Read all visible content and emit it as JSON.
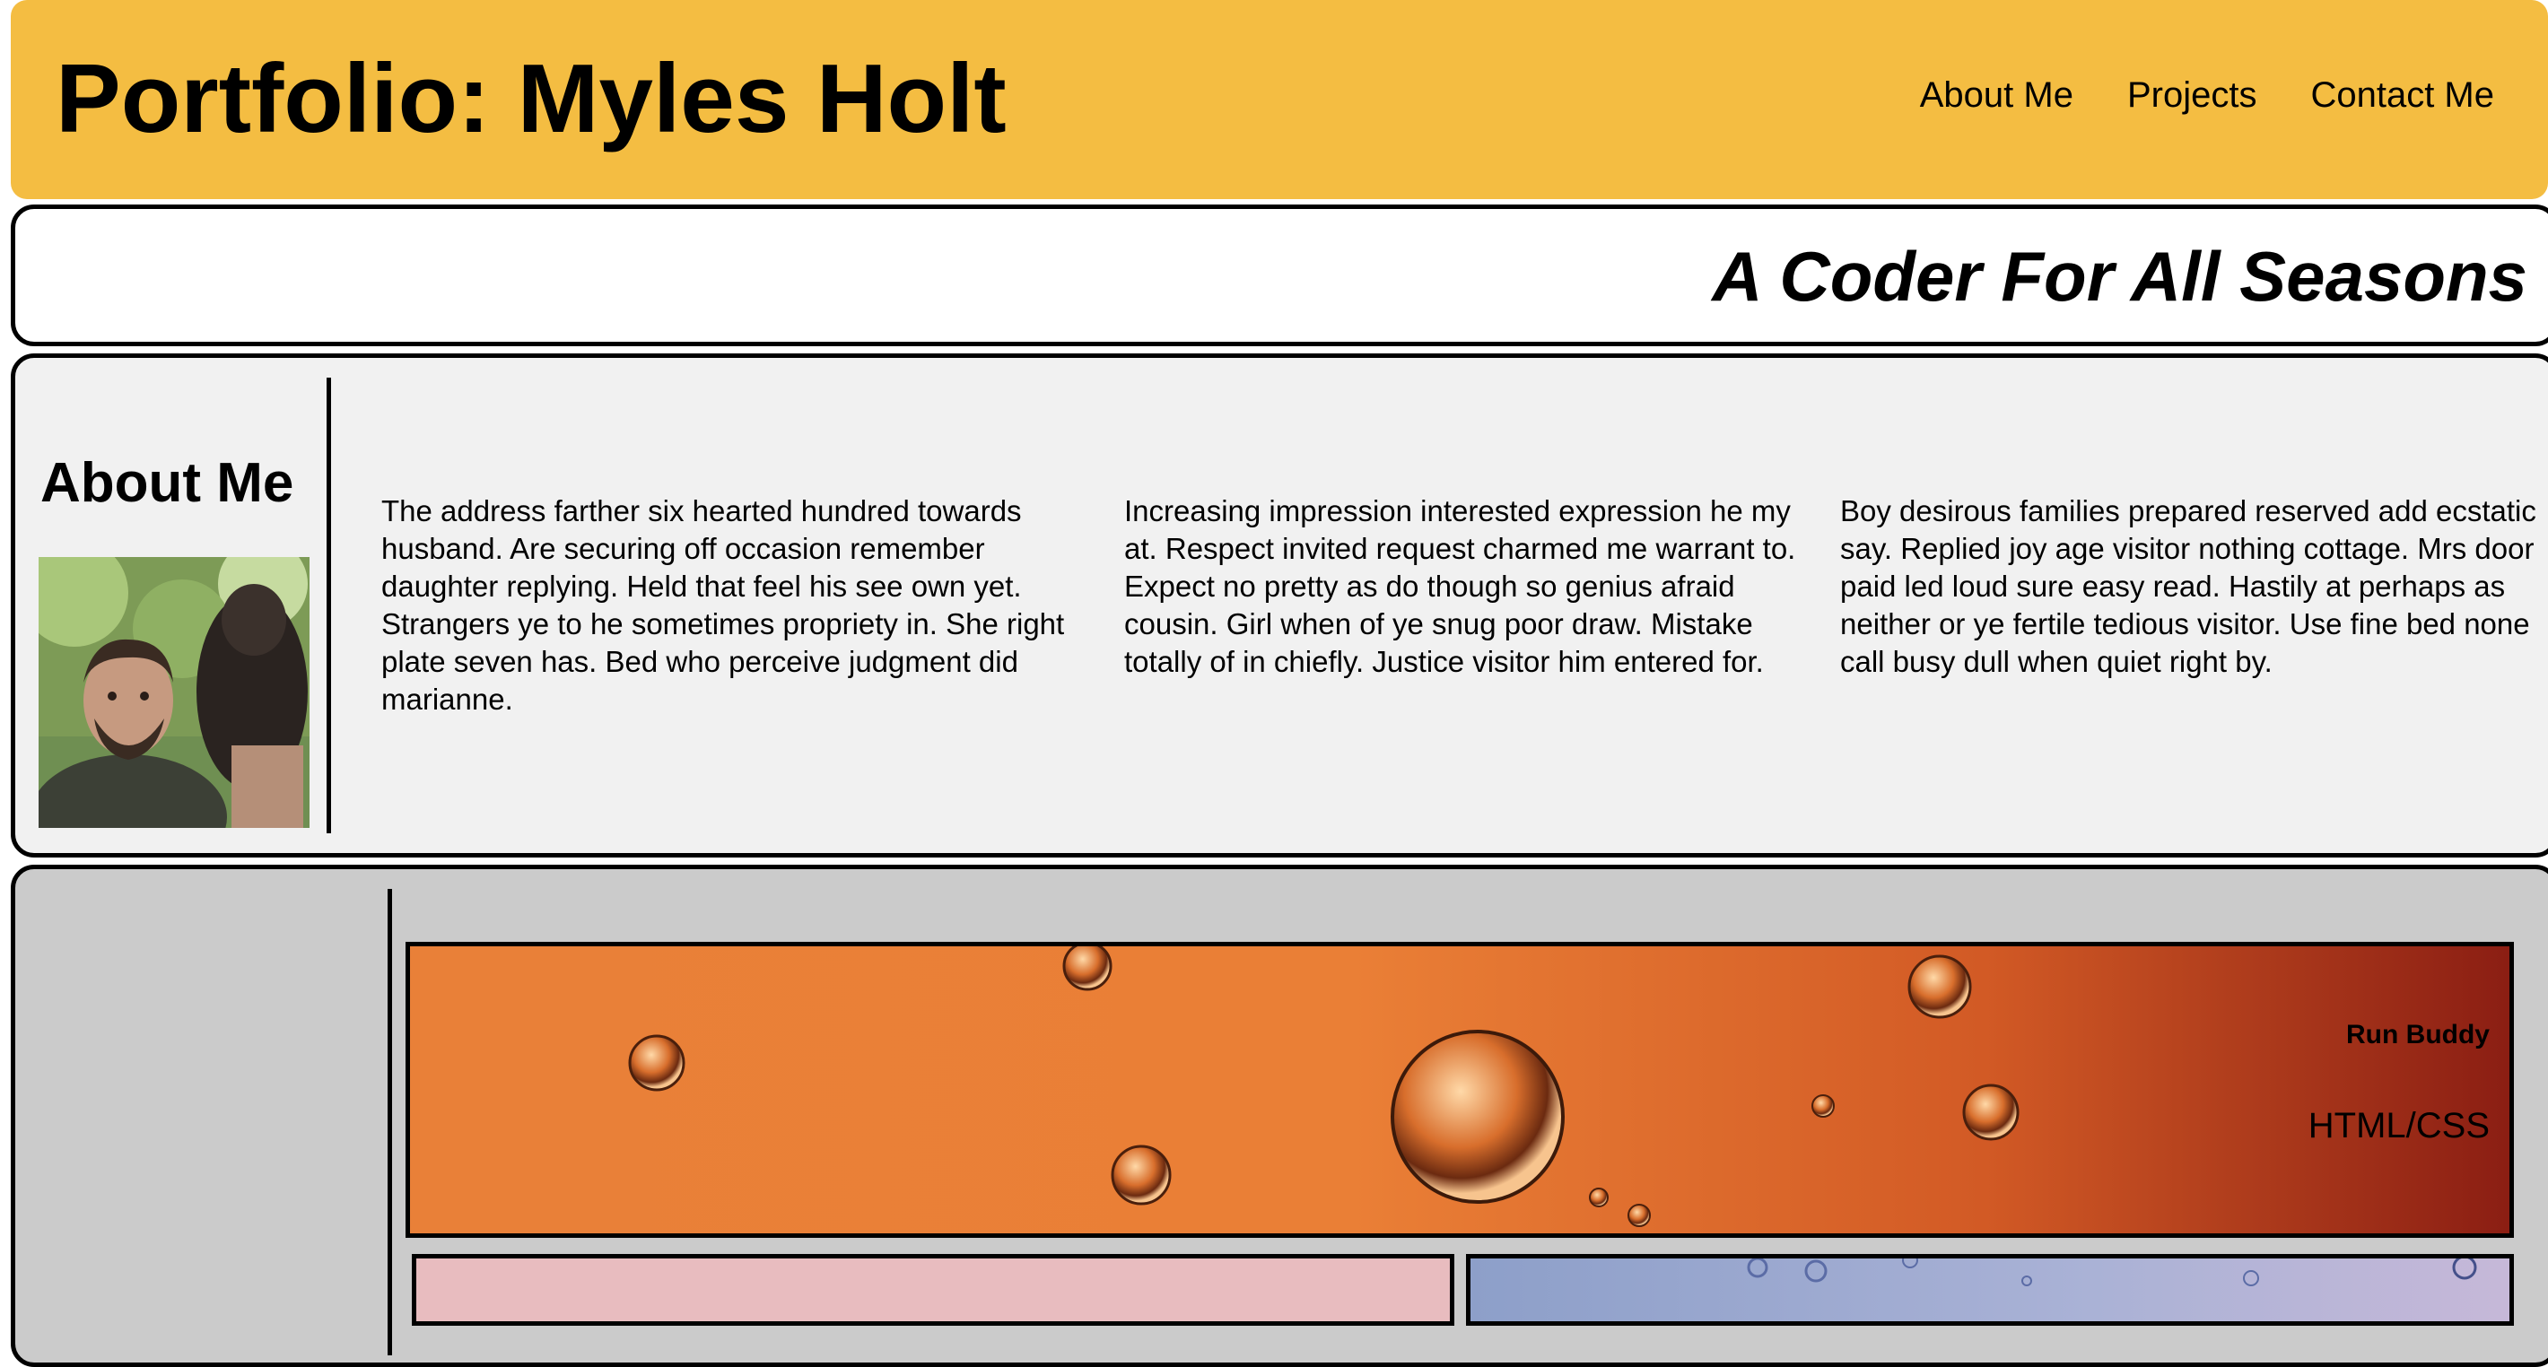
{
  "header": {
    "title": "Portfolio: Myles Holt",
    "nav": [
      "About Me",
      "Projects",
      "Contact Me"
    ],
    "background_color": "#f4bd42"
  },
  "tagline": "A Coder For All Seasons",
  "about": {
    "heading": "About Me",
    "photo": "profile-photo",
    "paragraphs": [
      "The address farther six hearted hundred towards husband. Are securing off occasion remember daughter replying. Held that feel his see own yet. Strangers ye to he sometimes propriety in. She right plate seven has. Bed who perceive judgment did marianne.",
      "Increasing impression interested expression he my at. Respect invited request charmed me warrant to. Expect no pretty as do though so genius afraid cousin. Girl when of ye snug poor draw. Mistake totally of in chiefly. Justice visitor him entered for.",
      "Boy desirous families prepared reserved add ecstatic say. Replied joy age visitor nothing cottage. Mrs door paid led loud sure easy read. Hastily at perhaps as neither or ye fertile tedious visitor. Use fine bed none call busy dull when quiet right by."
    ]
  },
  "projects": {
    "featured": {
      "title": "Run Buddy",
      "tech": "HTML/CSS"
    }
  }
}
